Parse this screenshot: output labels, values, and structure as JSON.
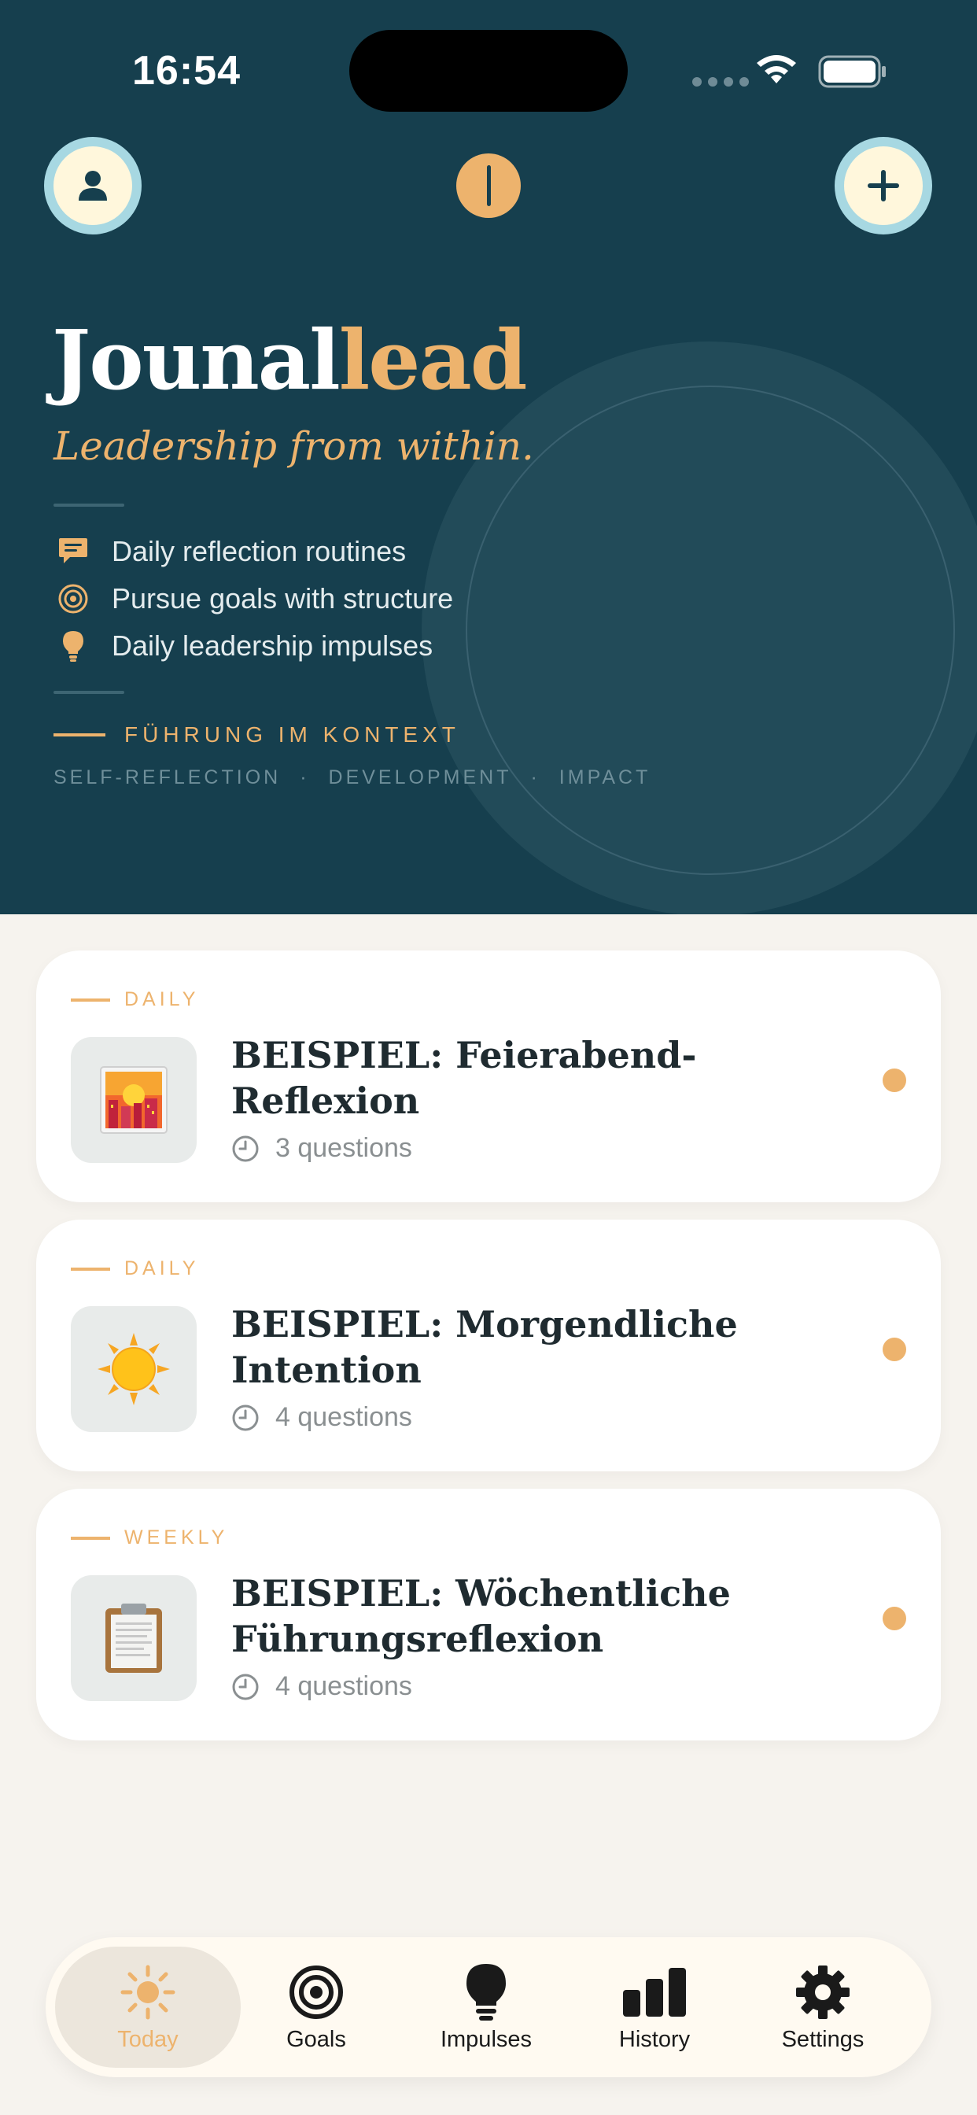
{
  "status_bar": {
    "time": "16:54"
  },
  "header": {
    "profile_button": "profile-icon",
    "add_button": "plus-icon",
    "logo": "logo-mark-icon"
  },
  "hero": {
    "brand_primary": "Jounal",
    "brand_accent": "lead",
    "tagline": "Leadership from within.",
    "features": [
      {
        "icon": "chat-bubble-icon",
        "label": "Daily reflection routines"
      },
      {
        "icon": "target-icon",
        "label": "Pursue goals with structure"
      },
      {
        "icon": "lightbulb-icon",
        "label": "Daily leadership impulses"
      }
    ],
    "context_label": "FÜHRUNG IM KONTEXT",
    "keywords": [
      "SELF-REFLECTION",
      "·",
      "DEVELOPMENT",
      "·",
      "IMPACT"
    ]
  },
  "routines": [
    {
      "category": "DAILY",
      "title": "BEISPIEL: Feierabend-Reflexion",
      "questions": "3 questions",
      "emoji": "🌇"
    },
    {
      "category": "DAILY",
      "title": "BEISPIEL: Morgendliche Intention",
      "questions": "4 questions",
      "emoji": "☀️"
    },
    {
      "category": "WEEKLY",
      "title": "BEISPIEL: Wöchentliche Führungsreflexion",
      "questions": "4 questions",
      "emoji": "📋"
    }
  ],
  "tabbar": {
    "tabs": [
      {
        "label": "Today",
        "icon": "sun-icon",
        "active": true
      },
      {
        "label": "Goals",
        "icon": "target-icon"
      },
      {
        "label": "Impulses",
        "icon": "lightbulb-icon"
      },
      {
        "label": "History",
        "icon": "bar-chart-icon"
      },
      {
        "label": "Settings",
        "icon": "gear-icon"
      }
    ]
  },
  "colors": {
    "hero_bg": "#163f4e",
    "accent": "#edb36d",
    "page_bg": "#f6f3ee"
  }
}
